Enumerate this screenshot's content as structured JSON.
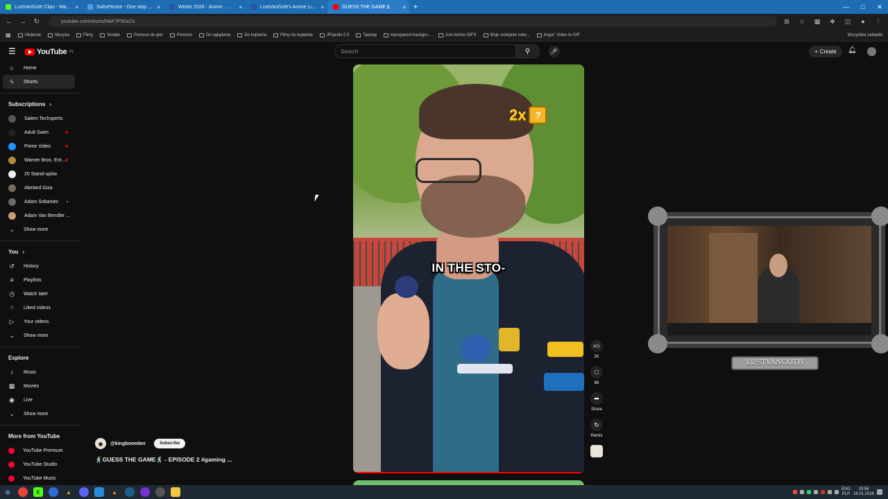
{
  "browser": {
    "tabs": [
      {
        "title": "LustVanGoth Clips - Watch Live",
        "color": "#53fc18"
      },
      {
        "title": "SubsPlease - One stop shop for",
        "color": "#5b9bd5"
      },
      {
        "title": "Winter 2026 - Anime - MyAnim",
        "color": "#2e51a2"
      },
      {
        "title": "LustVanGoth's Anime List - My",
        "color": "#2e51a2"
      },
      {
        "title": "GUESS THE GAME🕺",
        "color": "#ff0000",
        "active": true
      }
    ],
    "new_tab": "+",
    "url": "youtube.com/shorts/lAkF7P9DeZs",
    "bookmarks": [
      "Ulubione",
      "Muzyka",
      "Filmy",
      "Seriale",
      "Pomoce do gier",
      "Pomoce",
      "Do oglądania",
      "Do kupienia",
      "Filmy do kupienia",
      "JFopulki 2.0",
      "Tpexep",
      "transparent backgro...",
      "Just Anime GIFS",
      "Moje wstepnie zatw...",
      "Imgur: Video to GIF"
    ],
    "bookmarks_right": "Wszystkie zakładki"
  },
  "youtube": {
    "logo_text": "YouTube",
    "country": "PL",
    "search_placeholder": "Search",
    "create_label": "Create"
  },
  "sidebar": {
    "top": [
      {
        "label": "Home",
        "icon": "home-icon",
        "glyph": "⌂"
      },
      {
        "label": "Shorts",
        "icon": "shorts-icon",
        "glyph": "ϟ",
        "selected": true
      }
    ],
    "subscriptions_heading": "Subscriptions",
    "subscriptions": [
      {
        "label": "Salem Techsperts",
        "color": "#555",
        "marker": "none"
      },
      {
        "label": "Adult Swim",
        "color": "#222",
        "marker": "live"
      },
      {
        "label": "Prime Video",
        "color": "#1a98ff",
        "marker": "live"
      },
      {
        "label": "Warner Bros. Ent...",
        "color": "#b08a3e",
        "marker": "live"
      },
      {
        "label": "20 Stand-upów",
        "color": "#eee",
        "marker": "none"
      },
      {
        "label": "Abelard Giza",
        "color": "#7a6a5a",
        "marker": "none"
      },
      {
        "label": "Adam Sobaniec",
        "color": "#6a6a6a",
        "marker": "dot"
      },
      {
        "label": "Adam Van Bendler ...",
        "color": "#c7a070",
        "marker": "none"
      }
    ],
    "show_more_1": "Show more",
    "you_heading": "You",
    "you_items": [
      {
        "label": "History",
        "icon": "history-icon",
        "glyph": "↺"
      },
      {
        "label": "Playlists",
        "icon": "playlists-icon",
        "glyph": "≡"
      },
      {
        "label": "Watch later",
        "icon": "clock-icon",
        "glyph": "◷"
      },
      {
        "label": "Liked videos",
        "icon": "thumbs-up-icon",
        "glyph": "☝"
      },
      {
        "label": "Your videos",
        "icon": "your-videos-icon",
        "glyph": "▷"
      }
    ],
    "show_more_2": "Show more",
    "explore_heading": "Explore",
    "explore_items": [
      {
        "label": "Music",
        "icon": "music-icon",
        "glyph": "♪"
      },
      {
        "label": "Movies",
        "icon": "movies-icon",
        "glyph": "▦"
      },
      {
        "label": "Live",
        "icon": "live-icon",
        "glyph": "◉"
      }
    ],
    "show_more_3": "Show more",
    "more_heading": "More from YouTube",
    "more_items": [
      {
        "label": "YouTube Premium",
        "color": "#ff0033"
      },
      {
        "label": "YouTube Studio",
        "color": "#ff0033"
      },
      {
        "label": "YouTube Music",
        "color": "#ff0033"
      }
    ]
  },
  "short": {
    "caption": "IN THE STO-",
    "badge_text": "2x",
    "badge_box": "?",
    "channel": "@kingboomber",
    "subscribe": "Subscribe",
    "title": "🕺GUESS THE GAME🕺 - EPISODE 2  #gaming ...",
    "progress": 1.0
  },
  "actions": {
    "like_count": "2K",
    "comment_count": "86",
    "share_label": "Share",
    "remix_label": "Remix"
  },
  "webcam": {
    "label": "LUSTVANGOTH"
  },
  "taskbar": {
    "language": "ENG",
    "layout": "PLP",
    "time": "19:56",
    "date": "18.01.2026"
  }
}
